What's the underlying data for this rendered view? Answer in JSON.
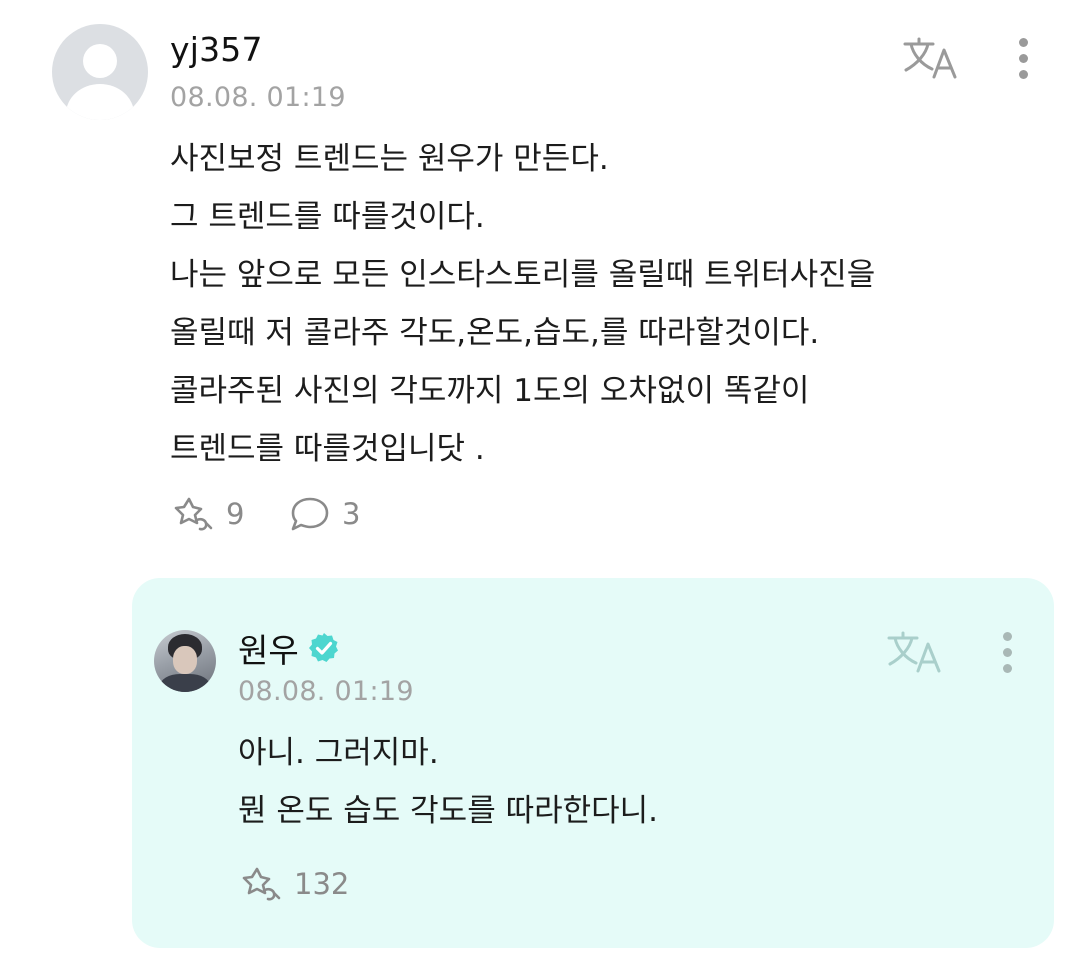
{
  "post": {
    "username": "yj357",
    "timestamp": "08.08. 01:19",
    "lines": [
      "사진보정 트렌드는 원우가 만든다.",
      "그 트렌드를 따를것이다.",
      "나는 앞으로 모든 인스타스토리를 올릴때 트위터사진을",
      "올릴때 저 콜라주 각도,온도,습도,를 따라할것이다.",
      "콜라주된 사진의 각도까지 1도의 오차없이 똑같이",
      "트렌드를 따를것입니닷 ."
    ],
    "like_count": "9",
    "reply_count": "3"
  },
  "reply": {
    "username": "원우",
    "timestamp": "08.08. 01:19",
    "lines": [
      "아니. 그러지마.",
      "뭔 온도 습도 각도를 따라한다니."
    ],
    "like_count": "132"
  },
  "icons": {
    "translate": "translate-icon",
    "more": "more-vertical-icon",
    "like": "like-icon",
    "comment": "comment-bubble-icon",
    "verified": "verified-badge-icon"
  },
  "colors": {
    "reply_background": "#e5fbf8",
    "verified_badge": "#4dd6cf",
    "timestamp": "#a3a3a3",
    "icon_gray": "#8a8a8a",
    "translate_post": "#9a9a9a",
    "translate_reply": "#a9cfcb"
  }
}
